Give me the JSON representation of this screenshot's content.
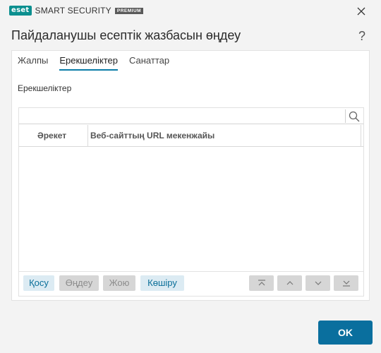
{
  "app": {
    "logo_badge": "eset",
    "logo_text": "SMART SECURITY",
    "logo_premium": "PREMIUM"
  },
  "dialog": {
    "title": "Пайдаланушы есептік жазбасын өңдеу",
    "help": "?"
  },
  "tabs": [
    {
      "label": "Жалпы",
      "active": false
    },
    {
      "label": "Ерекшеліктер",
      "active": true
    },
    {
      "label": "Санаттар",
      "active": false
    }
  ],
  "section_label": "Ерекшеліктер",
  "search": {
    "value": "",
    "placeholder": ""
  },
  "table": {
    "columns": [
      "Әрекет",
      "Веб-сайттың URL мекенжайы"
    ],
    "rows": []
  },
  "toolbar": {
    "add_label": "Қосу",
    "edit_label": "Өңдеу",
    "delete_label": "Жою",
    "copy_label": "Көшіру"
  },
  "ok_label": "OK",
  "colors": {
    "accent": "#0a6f9e",
    "logo": "#0b8f8f",
    "enabled_button_bg": "#dcebf3",
    "disabled_button_bg": "#d6d6d6"
  },
  "icons": [
    "close-icon",
    "help-icon",
    "search-icon",
    "move-top-icon",
    "move-up-icon",
    "move-down-icon",
    "move-bottom-icon"
  ]
}
